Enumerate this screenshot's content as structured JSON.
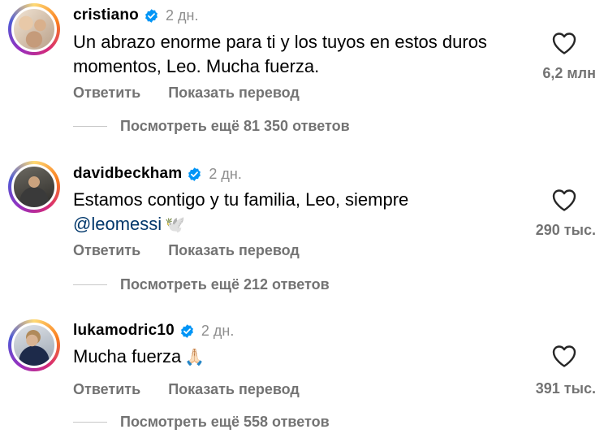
{
  "comments": [
    {
      "username": "cristiano",
      "time": "2 дн.",
      "text": "Un abrazo enorme para ti y los tuyos en estos duros momentos, Leo. Mucha fuerza.",
      "mention": "",
      "emoji": "",
      "reply_label": "Ответить",
      "translate_label": "Показать перевод",
      "likes": "6,2 млн",
      "view_replies": "Посмотреть ещё 81 350 ответов"
    },
    {
      "username": "davidbeckham",
      "time": "2 дн.",
      "text": "Estamos contigo y tu familia, Leo, siempre",
      "mention": "@leomessi",
      "emoji": "🕊️",
      "reply_label": "Ответить",
      "translate_label": "Показать перевод",
      "likes": "290 тыс.",
      "view_replies": "Посмотреть ещё 212 ответов"
    },
    {
      "username": "lukamodric10",
      "time": "2 дн.",
      "text": "Mucha fuerza",
      "mention": "",
      "emoji": "🙏🏻",
      "reply_label": "Ответить",
      "translate_label": "Показать перевод",
      "likes": "391 тыс.",
      "view_replies": "Посмотреть ещё 558 ответов"
    }
  ],
  "icons": {
    "verified": "verified-badge-icon",
    "like": "heart-outline-icon"
  },
  "colors": {
    "verified": "#0095f6",
    "mention": "#00376b",
    "secondary_text": "#737373"
  }
}
